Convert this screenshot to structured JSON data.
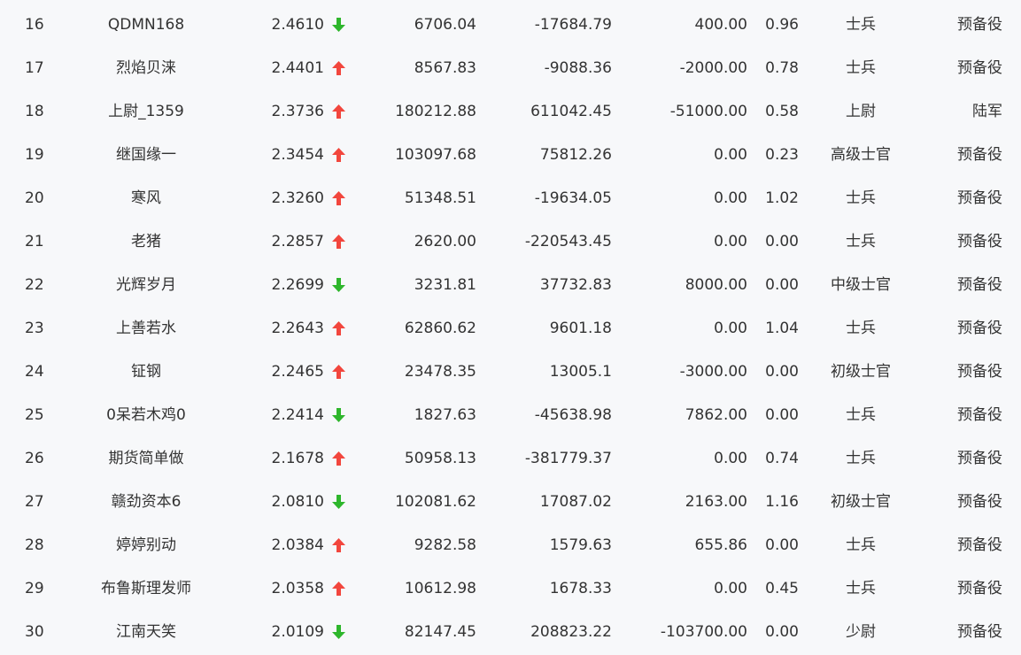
{
  "colors": {
    "up": "#f2463d",
    "down": "#2eb62c",
    "text": "#333333",
    "background": "#f7f8fa"
  },
  "icons": {
    "up": "arrow-up-icon",
    "down": "arrow-down-icon"
  },
  "rows": [
    {
      "rank": "16",
      "name": "QDMN168",
      "score": "2.4610",
      "trend": "down",
      "v1": "6706.04",
      "v2": "-17684.79",
      "v3": "400.00",
      "v4": "0.96",
      "rank_title": "士兵",
      "branch": "预备役"
    },
    {
      "rank": "17",
      "name": "烈焰贝涞",
      "score": "2.4401",
      "trend": "up",
      "v1": "8567.83",
      "v2": "-9088.36",
      "v3": "-2000.00",
      "v4": "0.78",
      "rank_title": "士兵",
      "branch": "预备役"
    },
    {
      "rank": "18",
      "name": "上尉_1359",
      "score": "2.3736",
      "trend": "up",
      "v1": "180212.88",
      "v2": "611042.45",
      "v3": "-51000.00",
      "v4": "0.58",
      "rank_title": "上尉",
      "branch": "陆军"
    },
    {
      "rank": "19",
      "name": "继国缘一",
      "score": "2.3454",
      "trend": "up",
      "v1": "103097.68",
      "v2": "75812.26",
      "v3": "0.00",
      "v4": "0.23",
      "rank_title": "高级士官",
      "branch": "预备役"
    },
    {
      "rank": "20",
      "name": "寒风",
      "score": "2.3260",
      "trend": "up",
      "v1": "51348.51",
      "v2": "-19634.05",
      "v3": "0.00",
      "v4": "1.02",
      "rank_title": "士兵",
      "branch": "预备役"
    },
    {
      "rank": "21",
      "name": "老猪",
      "score": "2.2857",
      "trend": "up",
      "v1": "2620.00",
      "v2": "-220543.45",
      "v3": "0.00",
      "v4": "0.00",
      "rank_title": "士兵",
      "branch": "预备役"
    },
    {
      "rank": "22",
      "name": "光辉岁月",
      "score": "2.2699",
      "trend": "down",
      "v1": "3231.81",
      "v2": "37732.83",
      "v3": "8000.00",
      "v4": "0.00",
      "rank_title": "中级士官",
      "branch": "预备役"
    },
    {
      "rank": "23",
      "name": "上善若水",
      "score": "2.2643",
      "trend": "up",
      "v1": "62860.62",
      "v2": "9601.18",
      "v3": "0.00",
      "v4": "1.04",
      "rank_title": "士兵",
      "branch": "预备役"
    },
    {
      "rank": "24",
      "name": "钲钢",
      "score": "2.2465",
      "trend": "up",
      "v1": "23478.35",
      "v2": "13005.1",
      "v3": "-3000.00",
      "v4": "0.00",
      "rank_title": "初级士官",
      "branch": "预备役"
    },
    {
      "rank": "25",
      "name": "0呆若木鸡0",
      "score": "2.2414",
      "trend": "down",
      "v1": "1827.63",
      "v2": "-45638.98",
      "v3": "7862.00",
      "v4": "0.00",
      "rank_title": "士兵",
      "branch": "预备役"
    },
    {
      "rank": "26",
      "name": "期货简单做",
      "score": "2.1678",
      "trend": "up",
      "v1": "50958.13",
      "v2": "-381779.37",
      "v3": "0.00",
      "v4": "0.74",
      "rank_title": "士兵",
      "branch": "预备役"
    },
    {
      "rank": "27",
      "name": "赣劲资本6",
      "score": "2.0810",
      "trend": "down",
      "v1": "102081.62",
      "v2": "17087.02",
      "v3": "2163.00",
      "v4": "1.16",
      "rank_title": "初级士官",
      "branch": "预备役"
    },
    {
      "rank": "28",
      "name": "婷婷别动",
      "score": "2.0384",
      "trend": "up",
      "v1": "9282.58",
      "v2": "1579.63",
      "v3": "655.86",
      "v4": "0.00",
      "rank_title": "士兵",
      "branch": "预备役"
    },
    {
      "rank": "29",
      "name": "布鲁斯理发师",
      "score": "2.0358",
      "trend": "up",
      "v1": "10612.98",
      "v2": "1678.33",
      "v3": "0.00",
      "v4": "0.45",
      "rank_title": "士兵",
      "branch": "预备役"
    },
    {
      "rank": "30",
      "name": "江南天笑",
      "score": "2.0109",
      "trend": "down",
      "v1": "82147.45",
      "v2": "208823.22",
      "v3": "-103700.00",
      "v4": "0.00",
      "rank_title": "少尉",
      "branch": "预备役"
    }
  ]
}
